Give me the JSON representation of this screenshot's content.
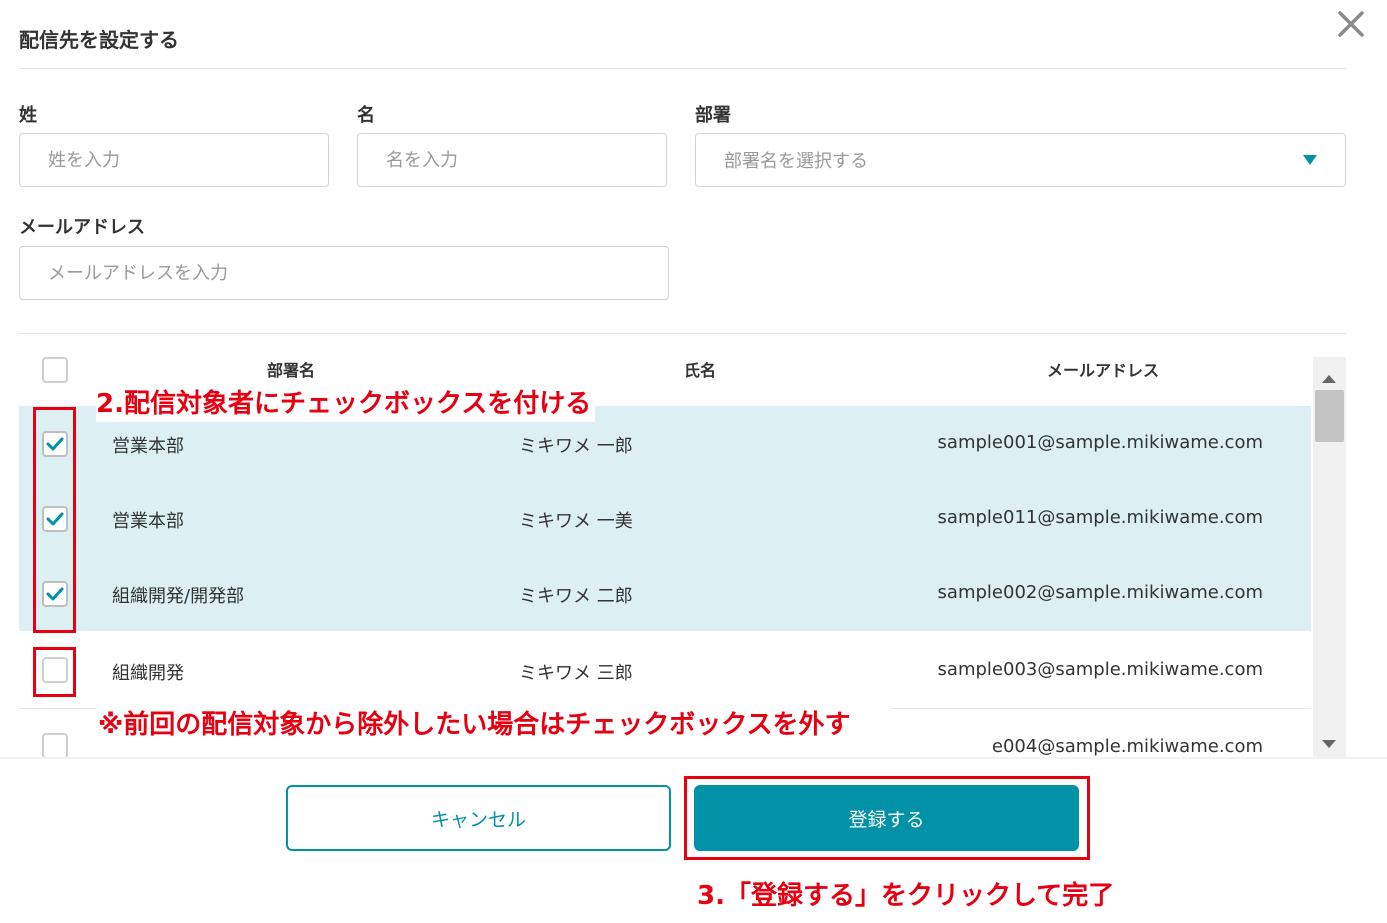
{
  "dialog": {
    "title": "配信先を設定する",
    "close_icon": "close-icon"
  },
  "filters": {
    "last_name": {
      "label": "姓",
      "placeholder": "姓を入力",
      "value": ""
    },
    "first_name": {
      "label": "名",
      "placeholder": "名を入力",
      "value": ""
    },
    "department": {
      "label": "部署",
      "placeholder": "部署名を選択する",
      "icon": "chevron-down-icon"
    },
    "email": {
      "label": "メールアドレス",
      "placeholder": "メールアドレスを入力",
      "value": ""
    }
  },
  "table": {
    "headers": {
      "department": "部署名",
      "name": "氏名",
      "email": "メールアドレス"
    },
    "select_all_checked": false,
    "rows": [
      {
        "department": "営業本部",
        "name": "ミキワメ 一郎",
        "email": "sample001@sample.mikiwame.com",
        "checked": true
      },
      {
        "department": "営業本部",
        "name": "ミキワメ 一美",
        "email": "sample011@sample.mikiwame.com",
        "checked": true
      },
      {
        "department": "組織開発/開発部",
        "name": "ミキワメ 二郎",
        "email": "sample002@sample.mikiwame.com",
        "checked": true
      },
      {
        "department": "組織開発",
        "name": "ミキワメ 三郎",
        "email": "sample003@sample.mikiwame.com",
        "checked": false
      },
      {
        "department": "",
        "name": "",
        "email": "e004@sample.mikiwame.com",
        "checked": false
      }
    ]
  },
  "footer": {
    "cancel_label": "キャンセル",
    "submit_label": "登録する"
  },
  "annotations": {
    "step2": "2.配信対象者にチェックボックスを付ける",
    "note": "※前回の配信対象から除外したい場合はチェックボックスを外す",
    "step3": "3.「登録する」をクリックして完了"
  },
  "colors": {
    "accent": "#0192a8",
    "selected_row": "#dcf0f3",
    "annotation_red": "#e60012"
  }
}
